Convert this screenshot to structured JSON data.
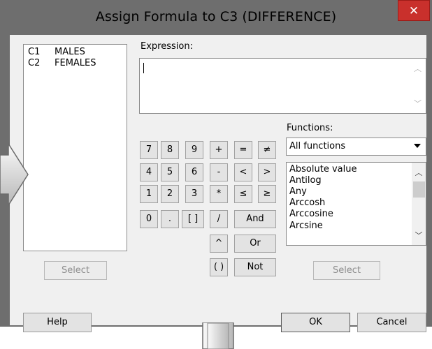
{
  "window": {
    "title": "Assign Formula to C3 (DIFFERENCE)",
    "close_label": "✕"
  },
  "variables": [
    {
      "id": "C1",
      "name": "MALES"
    },
    {
      "id": "C2",
      "name": "FEMALES"
    }
  ],
  "expression": {
    "label": "Expression:",
    "value": ""
  },
  "keypad": {
    "digits": [
      "7",
      "8",
      "9",
      "4",
      "5",
      "6",
      "1",
      "2",
      "3",
      "0",
      ".",
      "[ ]"
    ],
    "ops": [
      "+",
      "-",
      "*",
      "/",
      "^",
      "( )"
    ],
    "compare": [
      "=",
      "≠",
      "<",
      ">",
      "≤",
      "≥"
    ],
    "logic": [
      "And",
      "Or",
      "Not"
    ]
  },
  "functions": {
    "label": "Functions:",
    "selected": "All functions",
    "items": [
      "Absolute value",
      "Antilog",
      "Any",
      "Arccosh",
      "Arccosine",
      "Arcsine"
    ]
  },
  "buttons": {
    "select_left": "Select",
    "select_right": "Select",
    "help": "Help",
    "ok": "OK",
    "cancel": "Cancel"
  },
  "icons": [
    "close-icon",
    "right-arrow-icon",
    "down-arrow-icon",
    "chevron-down-icon",
    "scroll-up-icon",
    "scroll-down-icon"
  ]
}
